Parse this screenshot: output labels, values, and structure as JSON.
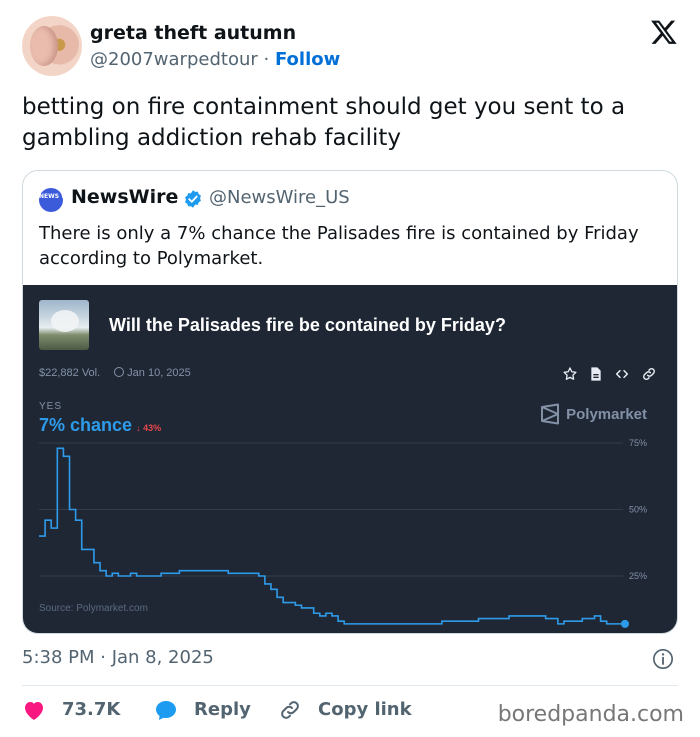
{
  "author": {
    "name": "greta theft autumn",
    "handle": "@2007warpedtour",
    "separator": "·",
    "follow_label": "Follow"
  },
  "tweet": {
    "text": "betting on fire containment should get you sent to a gambling addiction rehab facility"
  },
  "quote": {
    "avatar_text": "NEWS WIRE",
    "name": "NewsWire",
    "handle": "@NewsWire_US",
    "text": "There is only a 7% chance the Palisades fire is contained by Friday according to Polymarket."
  },
  "card": {
    "question": "Will the Palisades fire be contained by Friday?",
    "volume": "$22,882 Vol.",
    "date": "Jan 10, 2025",
    "outcome_label": "YES",
    "chance": "7% chance",
    "change": "↓ 43%",
    "brand": "Polymarket",
    "source": "Source: Polymarket.com",
    "colors": {
      "background": "#1f2735",
      "line": "#2e9bea",
      "grid": "#323c4d",
      "down": "#e5484d"
    }
  },
  "chart_data": {
    "type": "line",
    "title": "Will the Palisades fire be contained by Friday?",
    "xlabel": "",
    "ylabel": "",
    "ylim": [
      0,
      100
    ],
    "y_ticks": [
      "75%",
      "50%",
      "25%"
    ],
    "y_tick_values": [
      75,
      50,
      25
    ],
    "grid": true,
    "series": [
      {
        "values": [
          40,
          46,
          43,
          73,
          70,
          50,
          46,
          35,
          35,
          30,
          27,
          25,
          26,
          25,
          25,
          26,
          25,
          25,
          25,
          25,
          26,
          26,
          26,
          27,
          27,
          27,
          27,
          27,
          27,
          27,
          27,
          26,
          26,
          26,
          26,
          26,
          25,
          22,
          20,
          17,
          15,
          15,
          14,
          13,
          13,
          11,
          10,
          11,
          10,
          8,
          7,
          7,
          7,
          7,
          7,
          7,
          7,
          7,
          7,
          7,
          7,
          7,
          7,
          7,
          7,
          7,
          8,
          8,
          8,
          8,
          8,
          8,
          9,
          9,
          9,
          9,
          9,
          10,
          10,
          10,
          10,
          10,
          10,
          9,
          9,
          7,
          8,
          8,
          8,
          9,
          9,
          10,
          8,
          7,
          7,
          7,
          7
        ]
      }
    ]
  },
  "timestamp": "5:38 PM · Jan 8, 2025",
  "actions": {
    "likes": "73.7K",
    "reply": "Reply",
    "copy_link": "Copy link"
  },
  "watermark": "boredpanda.com",
  "icons": [
    "x-logo-icon",
    "verified-badge-icon",
    "star-icon",
    "document-icon",
    "code-icon",
    "link-icon",
    "polymarket-logo-icon",
    "info-icon",
    "heart-icon",
    "reply-icon",
    "copy-link-icon"
  ]
}
